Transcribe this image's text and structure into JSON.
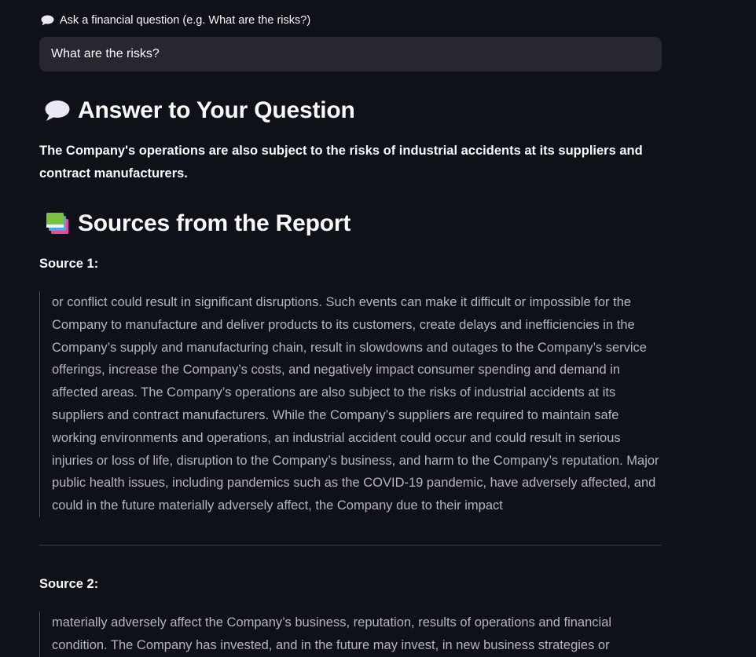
{
  "question": {
    "label": "Ask a financial question (e.g. What are the risks?)",
    "value": "What are the risks?",
    "icon": "speech-balloon-icon"
  },
  "answer": {
    "heading": "Answer to Your Question",
    "icon": "speech-balloon-icon",
    "text": "The Company's operations are also subject to the risks of industrial accidents at its suppliers and contract manufacturers."
  },
  "sources": {
    "heading": "Sources from the Report",
    "icon": "books-icon",
    "items": [
      {
        "label": "Source 1:",
        "text": "or conflict could result in significant disruptions. Such events can make it difficult or impossible for the Company to manufacture and deliver products to its customers, create delays and inefficiencies in the Company’s supply and manufacturing chain, result in slowdowns and outages to the Company’s service offerings, increase the Company’s costs, and negatively impact consumer spending and demand in affected areas. The Company’s operations are also subject to the risks of industrial accidents at its suppliers and contract manufacturers. While the Company’s suppliers are required to maintain safe working environments and operations, an industrial accident could occur and could result in serious injuries or loss of life, disruption to the Company’s business, and harm to the Company’s reputation. Major public health issues, including pandemics such as the COVID-19 pandemic, have adversely affected, and could in the future materially adversely affect, the Company due to their impact"
      },
      {
        "label": "Source 2:",
        "text": "materially adversely affect the Company’s business, reputation, results of operations and financial condition. The Company has invested, and in the future may invest, in new business strategies or"
      }
    ]
  },
  "colors": {
    "background": "#0e1117",
    "input_background": "#262730",
    "text": "#fafafa",
    "quote_text": "#b4b6bc"
  }
}
